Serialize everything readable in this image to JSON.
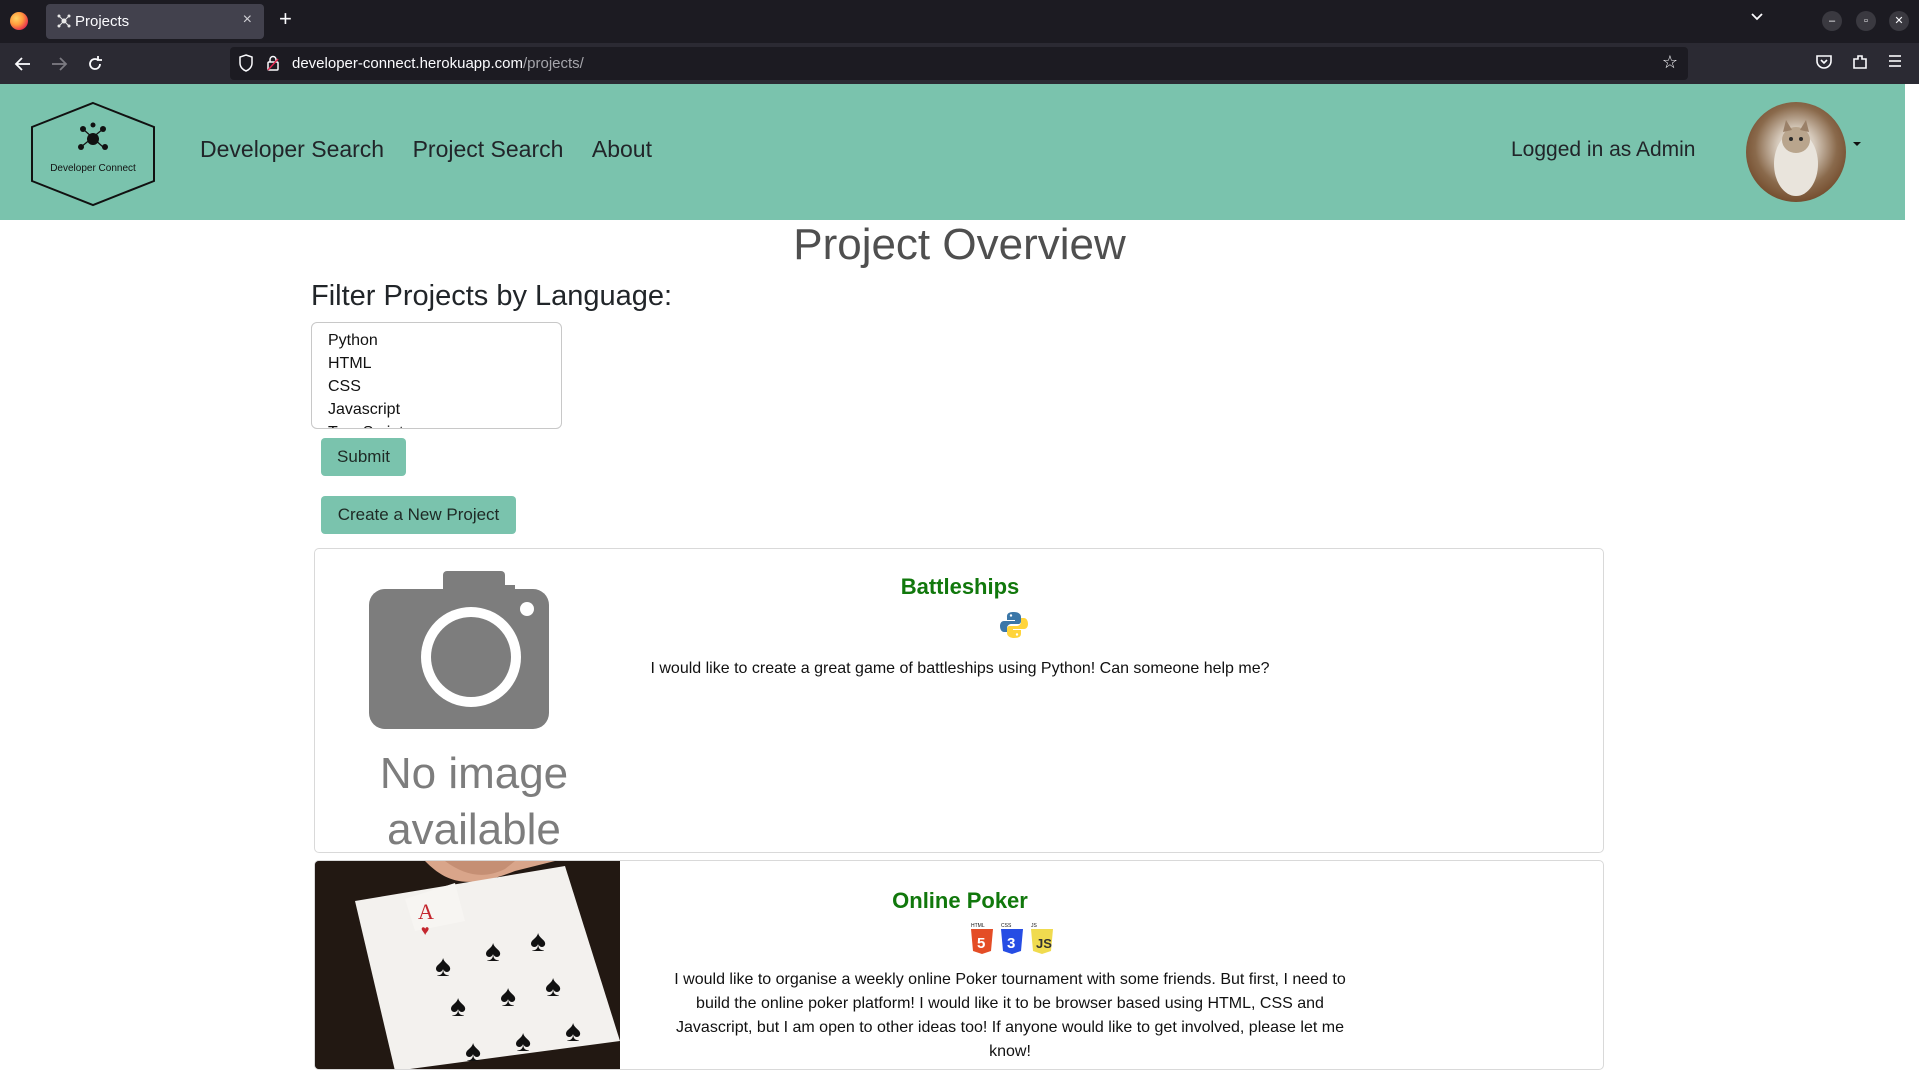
{
  "browser": {
    "tab_title": "Projects",
    "tab_close": "×",
    "new_tab": "+",
    "url_host": "developer-connect.herokuapp.com",
    "url_path": "/projects/"
  },
  "header": {
    "logo_text": "Developer Connect",
    "nav": [
      "Developer Search",
      "Project Search",
      "About"
    ],
    "logged_in": "Logged in as Admin"
  },
  "main": {
    "title": "Project Overview",
    "filter_heading": "Filter Projects by Language:",
    "languages": [
      "Python",
      "HTML",
      "CSS",
      "Javascript",
      "TypeScript"
    ],
    "submit_label": "Submit",
    "create_label": "Create a New Project",
    "projects": [
      {
        "title": "Battleships",
        "no_image_line1": "No image",
        "no_image_line2": "available",
        "description": "I would like to create a great game of battleships using Python! Can someone help me?",
        "languages": [
          "Python"
        ]
      },
      {
        "title": "Online Poker",
        "description": "I would like to organise a weekly online Poker tournament with some friends. But first, I need to build the online poker platform! I would like it to be browser based using HTML, CSS and Javascript, but I am open to other ideas too! If anyone would like to get involved, please let me know!",
        "languages": [
          "HTML",
          "CSS",
          "Javascript"
        ]
      }
    ]
  },
  "colors": {
    "header_bg": "#7ac3ad",
    "project_title": "#11780c",
    "page_title": "#4f4f4f"
  }
}
